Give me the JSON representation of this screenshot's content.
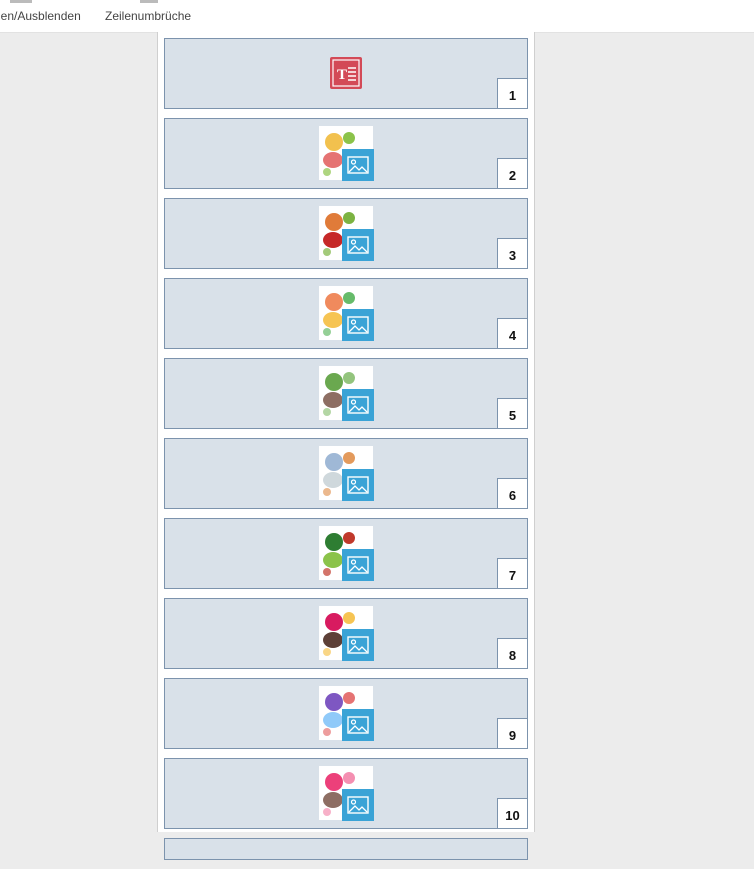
{
  "toolbar": {
    "show_hide_label": "den/Ausblenden",
    "line_breaks_label": "Zeilenumbrüche"
  },
  "slides": [
    {
      "number": "1",
      "kind": "text",
      "icon": "text-block-icon"
    },
    {
      "number": "2",
      "kind": "image",
      "icon": "image-icon",
      "thumb_colors": [
        "#f2c14e",
        "#8bc34a",
        "#e57373"
      ]
    },
    {
      "number": "3",
      "kind": "image",
      "icon": "image-icon",
      "thumb_colors": [
        "#e07b39",
        "#7cb342",
        "#c62828"
      ]
    },
    {
      "number": "4",
      "kind": "image",
      "icon": "image-icon",
      "thumb_colors": [
        "#f08a5d",
        "#66bb6a",
        "#f6c453"
      ]
    },
    {
      "number": "5",
      "kind": "image",
      "icon": "image-icon",
      "thumb_colors": [
        "#6aa84f",
        "#93c47d",
        "#8d6e63"
      ]
    },
    {
      "number": "6",
      "kind": "image",
      "icon": "image-icon",
      "thumb_colors": [
        "#9fb8d6",
        "#e39a5c",
        "#cfd8dc"
      ]
    },
    {
      "number": "7",
      "kind": "image",
      "icon": "image-icon",
      "thumb_colors": [
        "#2e7d32",
        "#c0392b",
        "#8bc34a"
      ]
    },
    {
      "number": "8",
      "kind": "image",
      "icon": "image-icon",
      "thumb_colors": [
        "#d81b60",
        "#f6c453",
        "#5d4037"
      ]
    },
    {
      "number": "9",
      "kind": "image",
      "icon": "image-icon",
      "thumb_colors": [
        "#7e57c2",
        "#e57373",
        "#90caf9"
      ]
    },
    {
      "number": "10",
      "kind": "image",
      "icon": "image-icon",
      "thumb_colors": [
        "#ec407a",
        "#f48fb1",
        "#8d6e63"
      ]
    }
  ],
  "colors": {
    "slide_bg": "#d9e1e9",
    "slide_border": "#7c93ad",
    "text_icon_bg": "#d34a57",
    "image_badge_bg": "#3aa3d6"
  }
}
